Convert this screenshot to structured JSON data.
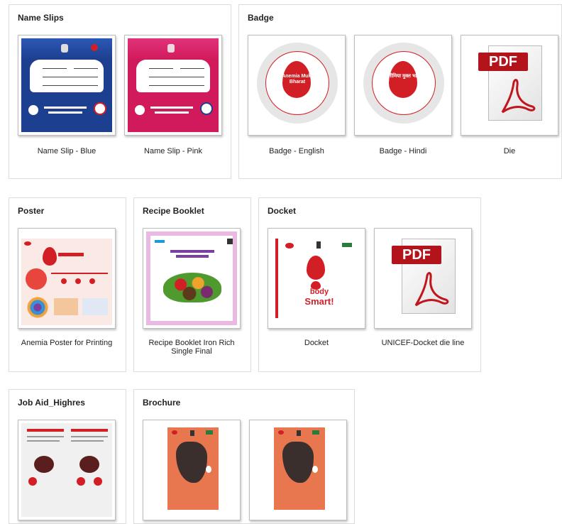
{
  "sections": {
    "name_slips": {
      "title": "Name Slips",
      "items": [
        {
          "caption": "Name Slip - Blue",
          "color": "#1d3f8f"
        },
        {
          "caption": "Name Slip - Pink",
          "color": "#d11a5c"
        }
      ]
    },
    "badge": {
      "title": "Badge",
      "items": [
        {
          "caption": "Badge - English",
          "logo": "Anemia Mukt Bharat"
        },
        {
          "caption": "Badge - Hindi",
          "logo": "एनीमिया मुक्त भारत"
        },
        {
          "caption": "Die",
          "icon": "pdf-icon"
        }
      ]
    },
    "poster": {
      "title": "Poster",
      "items": [
        {
          "caption": "Anemia Poster for Printing"
        }
      ]
    },
    "recipe_booklet": {
      "title": "Recipe Booklet",
      "items": [
        {
          "caption": "Recipe Booklet Iron Rich Single Final"
        }
      ]
    },
    "docket": {
      "title": "Docket",
      "items": [
        {
          "caption": "Docket",
          "tagline_1": "body",
          "tagline_2": "Smart!"
        },
        {
          "caption": "UNICEF-Docket die line",
          "icon": "pdf-icon"
        }
      ]
    },
    "job_aid": {
      "title": "Job Aid_Highres",
      "items": [
        {
          "caption": ""
        }
      ]
    },
    "brochure": {
      "title": "Brochure",
      "items": [
        {
          "caption": ""
        },
        {
          "caption": ""
        }
      ]
    }
  },
  "pdf_label": "PDF",
  "colors": {
    "accent_red": "#d21f26",
    "pdf_red": "#b3141b"
  }
}
